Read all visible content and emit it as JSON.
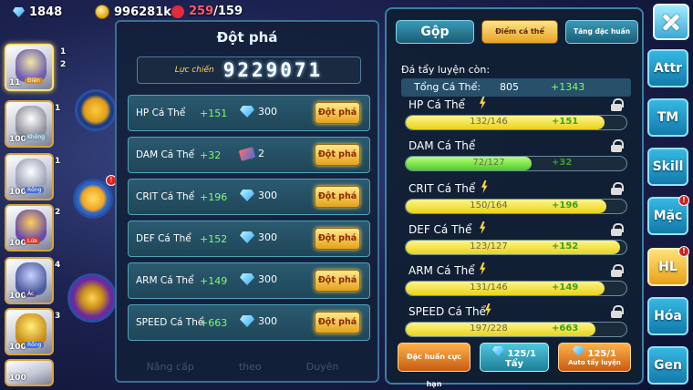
{
  "resources": {
    "gems": "1848",
    "gold": "996281k",
    "stamina_current": "259",
    "stamina_max": "/159"
  },
  "roster": [
    {
      "level": "11",
      "type": "Điện",
      "stars": "1",
      "stars2": "2",
      "active": true
    },
    {
      "level": "100",
      "type": "Không",
      "stars": "1"
    },
    {
      "level": "100",
      "type": "Rồng",
      "stars": "1"
    },
    {
      "level": "100",
      "type": "Lửa",
      "stars": "2"
    },
    {
      "level": "100",
      "type": "Ác",
      "stars": "4"
    },
    {
      "level": "100",
      "type": "Rồng",
      "stars": "3"
    },
    {
      "level": "100",
      "type": "",
      "stars": ""
    }
  ],
  "breakthrough": {
    "title": "Đột phá",
    "power_label": "Lực chiến",
    "power_value": "9229071",
    "button_label": "Đột phá",
    "rows": [
      {
        "name": "HP Cá Thể",
        "bonus": "+151",
        "cost": "300",
        "currency": "gem-icon"
      },
      {
        "name": "DAM Cá Thể",
        "bonus": "+32",
        "cost": "2",
        "currency": "scroll-icon"
      },
      {
        "name": "CRIT Cá Thể",
        "bonus": "+196",
        "cost": "300",
        "currency": "gem-icon"
      },
      {
        "name": "DEF Cá Thể",
        "bonus": "+152",
        "cost": "300",
        "currency": "gem-icon"
      },
      {
        "name": "ARM Cá Thể",
        "bonus": "+149",
        "cost": "300",
        "currency": "gem-icon"
      },
      {
        "name": "SPEED Cá Thể",
        "bonus": "+663",
        "cost": "300",
        "currency": "gem-icon"
      }
    ]
  },
  "bottom_tabs": [
    "Nâng cấp",
    "theo",
    "Duyên"
  ],
  "right_panel": {
    "tabs": {
      "merge": "Gộp",
      "individual_points": "Điểm cá thể",
      "special_training": "Tăng đặc huấn"
    },
    "remaining_label": "Đá tẩy luyện còn:",
    "total": {
      "label": "Tổng Cá Thể:",
      "value": "805",
      "bonus": "+1343"
    },
    "stats": [
      {
        "name": "HP Cá Thể",
        "value": "132/146",
        "bonus": "+151",
        "fill": 0.9,
        "color": "yellow",
        "bolt": true
      },
      {
        "name": "DAM Cá Thể",
        "value": "72/127",
        "bonus": "+32",
        "fill": 0.57,
        "color": "green",
        "bolt": false
      },
      {
        "name": "CRIT Cá Thể",
        "value": "150/164",
        "bonus": "+196",
        "fill": 0.91,
        "color": "yellow",
        "bolt": true
      },
      {
        "name": "DEF Cá Thể",
        "value": "123/127",
        "bonus": "+152",
        "fill": 0.97,
        "color": "yellow",
        "bolt": true
      },
      {
        "name": "ARM Cá Thể",
        "value": "131/146",
        "bonus": "+149",
        "fill": 0.9,
        "color": "yellow",
        "bolt": true
      },
      {
        "name": "SPEED Cá Thể",
        "value": "197/228",
        "bonus": "+663",
        "fill": 0.86,
        "color": "yellow",
        "bolt": true
      }
    ],
    "buttons": {
      "special": "Đặc huấn cực hạn",
      "wash_count": "125/1",
      "wash": "Tẩy",
      "auto_count": "125/1",
      "auto": "Auto tẩy luyện"
    }
  },
  "side_nav": [
    {
      "label": "Attr",
      "badge": false,
      "style": "blue"
    },
    {
      "label": "TM",
      "badge": false,
      "style": "blue"
    },
    {
      "label": "Skill",
      "badge": false,
      "style": "blue"
    },
    {
      "label": "Mặc",
      "badge": true,
      "style": "blue"
    },
    {
      "label": "HL",
      "badge": true,
      "style": "gold"
    },
    {
      "label": "Hóa",
      "badge": false,
      "style": "blue"
    },
    {
      "label": "Gen",
      "badge": false,
      "style": "blue"
    }
  ],
  "badge_mark": "!"
}
